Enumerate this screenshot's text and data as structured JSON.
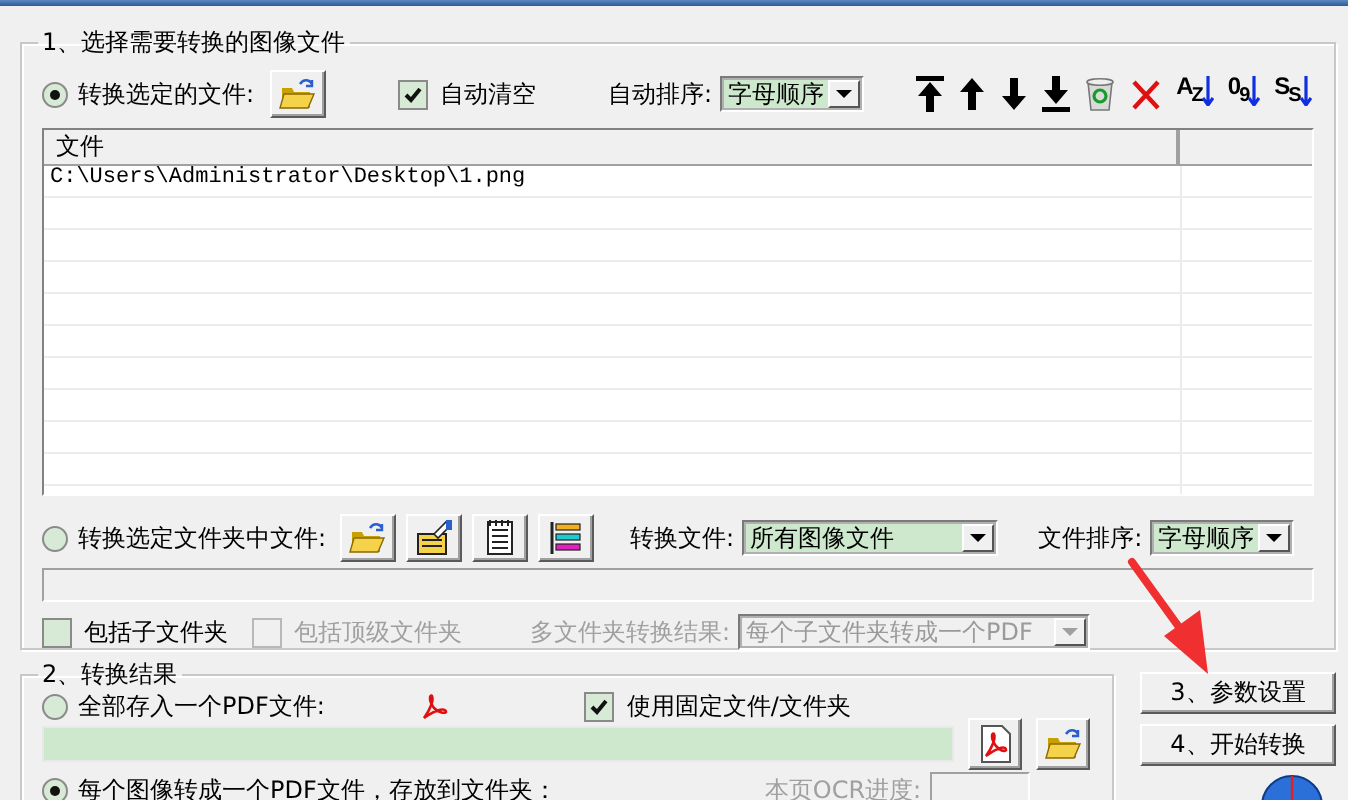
{
  "source": {
    "legend": "1、选择需要转换的图像文件",
    "file_mode": {
      "label": "转换选定的文件:",
      "selected": true
    },
    "auto_clear": {
      "label": "自动清空",
      "checked": true
    },
    "auto_sort": {
      "label": "自动排序:",
      "value": "字母顺序"
    },
    "toolbar": [
      {
        "kind": "top"
      },
      {
        "kind": "up"
      },
      {
        "kind": "down"
      },
      {
        "kind": "bottom"
      },
      {
        "kind": "recycle"
      },
      {
        "kind": "delete"
      },
      {
        "kind": "sort",
        "text": "A$_{Z}$"
      },
      {
        "kind": "sort",
        "text": "0$_{9}$"
      },
      {
        "kind": "sort",
        "text": "S$_{S}$"
      }
    ],
    "file_list": {
      "columns": [
        "文件"
      ],
      "rows": [
        "C:\\Users\\Administrator\\Desktop\\1.png"
      ]
    },
    "folder_mode": {
      "label": "转换选定文件夹中文件:",
      "selected": false
    },
    "folder_buttons": [
      {
        "kind": "open-folder"
      },
      {
        "kind": "folder-edit"
      },
      {
        "kind": "notepad"
      },
      {
        "kind": "list"
      }
    ],
    "filter": {
      "label": "转换文件:",
      "value": "所有图像文件"
    },
    "folder_sort": {
      "label": "文件排序:",
      "value": "字母顺序"
    },
    "include_subfolders": {
      "label": "包括子文件夹",
      "checked": false,
      "disabled": false
    },
    "include_top": {
      "label": "包括顶级文件夹",
      "checked": false,
      "disabled": true
    },
    "multi_result": {
      "label": "多文件夹转换结果:",
      "value": "每个子文件夹转成一个PDF",
      "disabled": true
    }
  },
  "output": {
    "legend": "2、转换结果",
    "single_pdf": {
      "label": "全部存入一个PDF文件:",
      "selected": false
    },
    "fixed_path": {
      "label": "使用固定文件/文件夹",
      "checked": true
    },
    "per_image": {
      "label": "每个图像转成一个PDF文件，存放到文件夹：",
      "selected": true
    },
    "ocr_label": "本页OCR进度:"
  },
  "actions": [
    "3、参数设置",
    "4、开始转换"
  ]
}
